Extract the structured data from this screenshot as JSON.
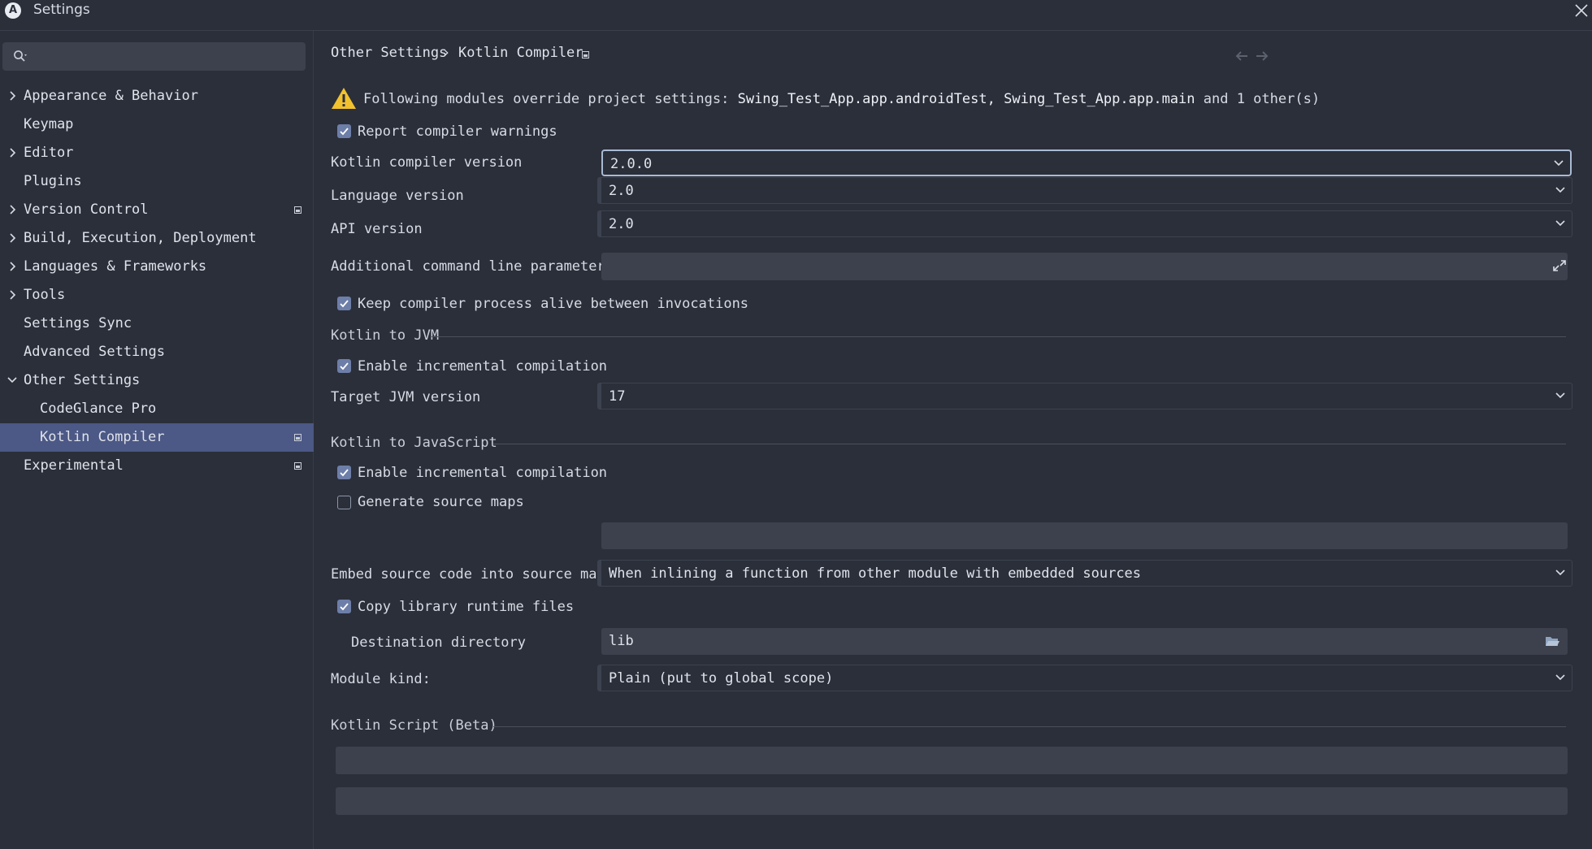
{
  "window": {
    "title": "Settings",
    "logo_letter": "A"
  },
  "sidebar": {
    "search_placeholder": "",
    "items": [
      {
        "label": "Appearance & Behavior",
        "expandable": true,
        "expanded": false,
        "level": 0,
        "project_icon": false
      },
      {
        "label": "Keymap",
        "expandable": false,
        "level": 0,
        "project_icon": false
      },
      {
        "label": "Editor",
        "expandable": true,
        "expanded": false,
        "level": 0,
        "project_icon": false
      },
      {
        "label": "Plugins",
        "expandable": false,
        "level": 0,
        "project_icon": false
      },
      {
        "label": "Version Control",
        "expandable": true,
        "expanded": false,
        "level": 0,
        "project_icon": true
      },
      {
        "label": "Build, Execution, Deployment",
        "expandable": true,
        "expanded": false,
        "level": 0,
        "project_icon": false
      },
      {
        "label": "Languages & Frameworks",
        "expandable": true,
        "expanded": false,
        "level": 0,
        "project_icon": false
      },
      {
        "label": "Tools",
        "expandable": true,
        "expanded": false,
        "level": 0,
        "project_icon": false
      },
      {
        "label": "Settings Sync",
        "expandable": false,
        "level": 0,
        "project_icon": false
      },
      {
        "label": "Advanced Settings",
        "expandable": false,
        "level": 0,
        "project_icon": false
      },
      {
        "label": "Other Settings",
        "expandable": true,
        "expanded": true,
        "level": 0,
        "project_icon": false
      },
      {
        "label": "CodeGlance Pro",
        "expandable": false,
        "level": 1,
        "project_icon": false
      },
      {
        "label": "Kotlin Compiler",
        "expandable": false,
        "level": 1,
        "project_icon": true,
        "selected": true
      },
      {
        "label": "Experimental",
        "expandable": false,
        "level": 0,
        "project_icon": true
      }
    ]
  },
  "breadcrumb": {
    "parent": "Other Settings",
    "separator": "›",
    "current": "Kotlin Compiler"
  },
  "warning": {
    "prefix": "Following modules override project settings:",
    "modules": "Swing_Test_App.app.androidTest, Swing_Test_App.app.main",
    "suffix": "and 1 other(s)"
  },
  "general": {
    "report_warnings": {
      "label": "Report compiler warnings",
      "checked": true
    },
    "compiler_version": {
      "label": "Kotlin compiler version",
      "value": "2.0.0"
    },
    "language_version": {
      "label": "Language version",
      "value": "2.0"
    },
    "api_version": {
      "label": "API version",
      "value": "2.0"
    },
    "additional_params": {
      "label": "Additional command line parameters:",
      "value": ""
    },
    "keep_alive": {
      "label": "Keep compiler process alive between invocations",
      "checked": true
    }
  },
  "jvm": {
    "title": "Kotlin to JVM",
    "incremental": {
      "label": "Enable incremental compilation",
      "checked": true
    },
    "target": {
      "label": "Target JVM version",
      "value": "17"
    }
  },
  "js": {
    "title": "Kotlin to JavaScript",
    "incremental": {
      "label": "Enable incremental compilation",
      "checked": true
    },
    "source_maps": {
      "label": "Generate source maps",
      "checked": false
    },
    "source_map_prefix": "",
    "embed": {
      "label": "Embed source code into source map:",
      "value": "When inlining a function from other module with embedded sources"
    },
    "copy_runtime": {
      "label": "Copy library runtime files",
      "checked": true
    },
    "destination": {
      "label": "Destination directory",
      "value": "lib"
    },
    "module_kind": {
      "label": "Module kind:",
      "value": "Plain (put to global scope)"
    }
  },
  "script": {
    "title": "Kotlin Script (Beta)",
    "field1": "",
    "field2": ""
  },
  "colors": {
    "background": "#2b2f3a",
    "selection": "#4c5885",
    "checkbox": "#6d7ea8",
    "warning": "#f2c12e",
    "field": "#3c414d"
  }
}
